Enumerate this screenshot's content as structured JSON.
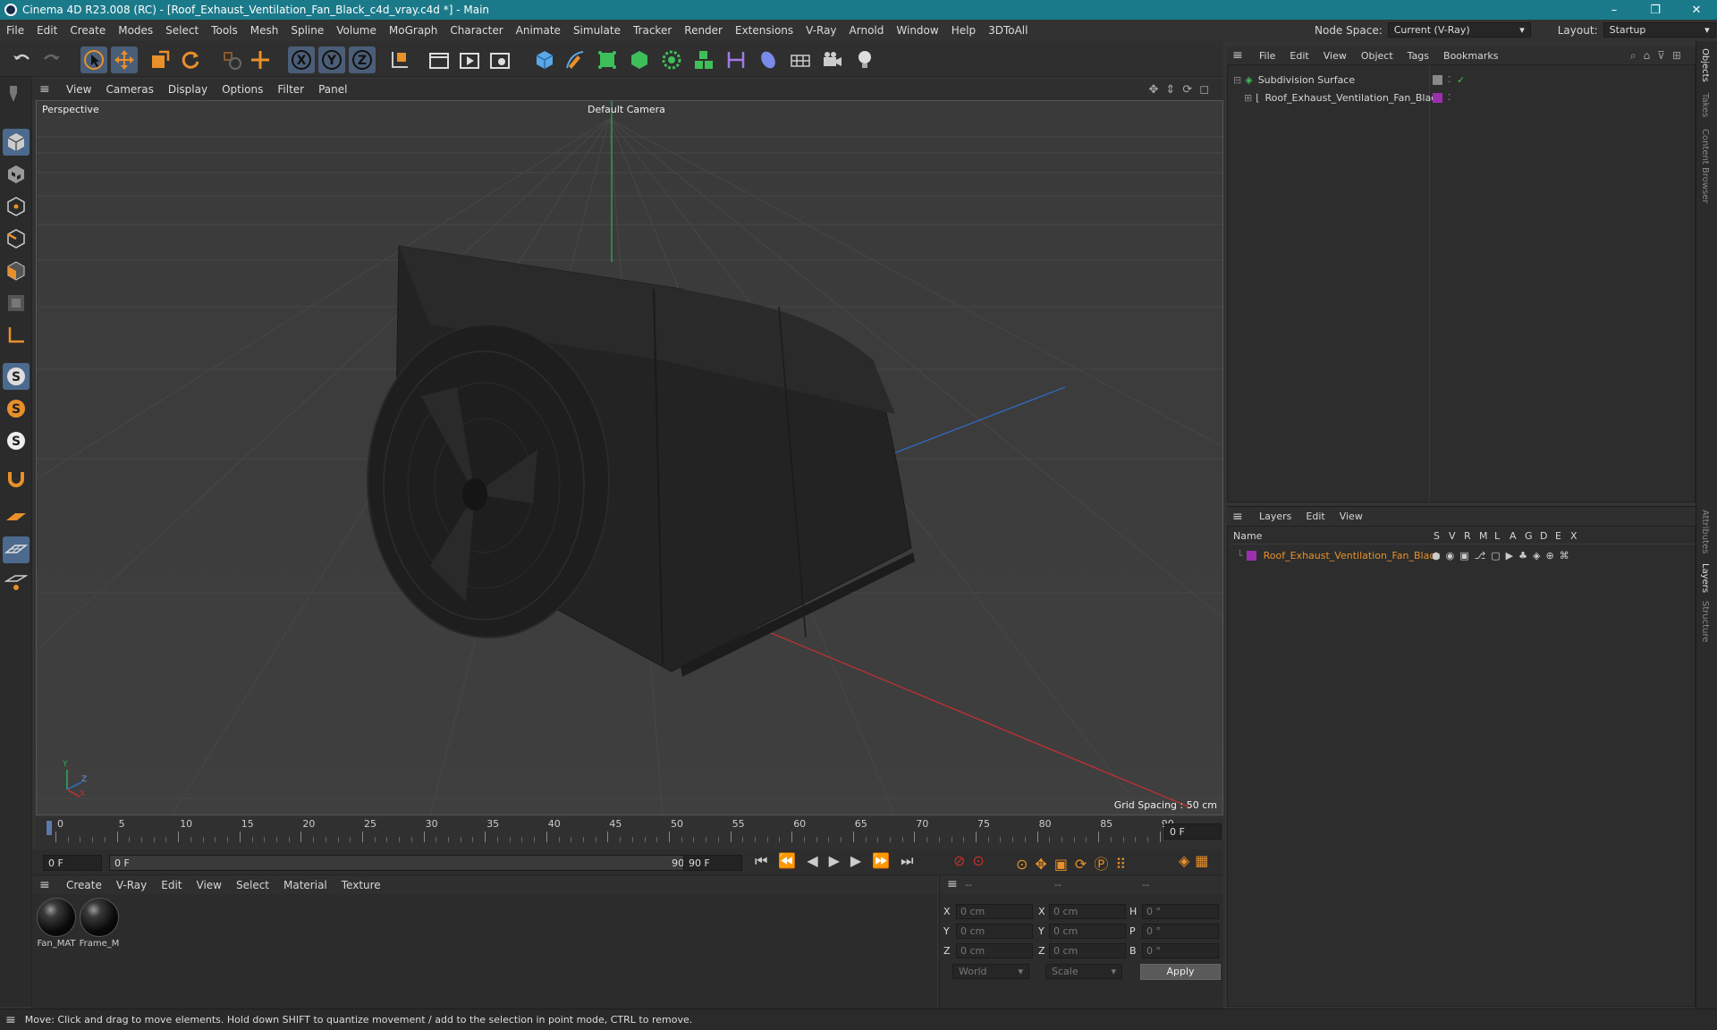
{
  "window": {
    "title": "Cinema 4D R23.008 (RC) - [Roof_Exhaust_Ventilation_Fan_Black_c4d_vray.c4d *] - Main",
    "controls": [
      "–",
      "❐",
      "✕"
    ]
  },
  "menubar": {
    "items": [
      "File",
      "Edit",
      "Create",
      "Modes",
      "Select",
      "Tools",
      "Mesh",
      "Spline",
      "Volume",
      "MoGraph",
      "Character",
      "Animate",
      "Simulate",
      "Tracker",
      "Render",
      "Extensions",
      "V-Ray",
      "Arnold",
      "Window",
      "Help",
      "3DToAll"
    ],
    "node_space_label": "Node Space:",
    "node_space_value": "Current (V-Ray)",
    "layout_label": "Layout:",
    "layout_value": "Startup"
  },
  "viewport": {
    "menu": [
      "View",
      "Cameras",
      "Display",
      "Options",
      "Filter",
      "Panel"
    ],
    "label": "Perspective",
    "camera": "Default Camera",
    "grid_spacing": "Grid Spacing : 50 cm",
    "axis_labels": {
      "y": "Y",
      "z": "Z",
      "x": "X"
    }
  },
  "timeline": {
    "ticks": [
      "0",
      "5",
      "10",
      "15",
      "20",
      "25",
      "30",
      "35",
      "40",
      "45",
      "50",
      "55",
      "60",
      "65",
      "70",
      "75",
      "80",
      "85",
      "90"
    ],
    "current_frame": "0 F",
    "start_field": "0 F",
    "range_start": "0 F",
    "range_end": "90 F",
    "end_field": "90 F",
    "right_field": "0 F"
  },
  "materials": {
    "menu": [
      "Create",
      "V-Ray",
      "Edit",
      "View",
      "Select",
      "Material",
      "Texture"
    ],
    "items": [
      {
        "name": "Fan_MAT"
      },
      {
        "name": "Frame_M"
      }
    ]
  },
  "coords": {
    "headers": [
      "--",
      "--",
      "--"
    ],
    "rows": [
      {
        "l1": "X",
        "v1": "0 cm",
        "l2": "X",
        "v2": "0 cm",
        "l3": "H",
        "v3": "0 °"
      },
      {
        "l1": "Y",
        "v1": "0 cm",
        "l2": "Y",
        "v2": "0 cm",
        "l3": "P",
        "v3": "0 °"
      },
      {
        "l1": "Z",
        "v1": "0 cm",
        "l2": "Z",
        "v2": "0 cm",
        "l3": "B",
        "v3": "0 °"
      }
    ],
    "mode1": "World",
    "mode2": "Scale",
    "apply": "Apply"
  },
  "objects": {
    "menu": [
      "File",
      "Edit",
      "View",
      "Object",
      "Tags",
      "Bookmarks"
    ],
    "rows": [
      {
        "name": "Subdivision Surface"
      },
      {
        "name": "Roof_Exhaust_Ventilation_Fan_Black"
      }
    ]
  },
  "layers": {
    "menu": [
      "Layers",
      "Edit",
      "View"
    ],
    "columns": [
      "Name",
      "S",
      "V",
      "R",
      "M",
      "L",
      "A",
      "G",
      "D",
      "E",
      "X"
    ],
    "rows": [
      {
        "name": "Roof_Exhaust_Ventilation_Fan_Black",
        "color": "#9b2fae"
      }
    ]
  },
  "side_tabs": [
    "Objects",
    "Takes",
    "Content Browser",
    "Attributes",
    "Layers",
    "Structure"
  ],
  "status": "Move: Click and drag to move elements. Hold down SHIFT to quantize movement / add to the selection in point mode, CTRL to remove.",
  "colors": {
    "accent": "#1b7a8a",
    "layer_purple": "#9b2fae",
    "orange_icon": "#e8902a",
    "selected_blue": "#4b5e78"
  }
}
